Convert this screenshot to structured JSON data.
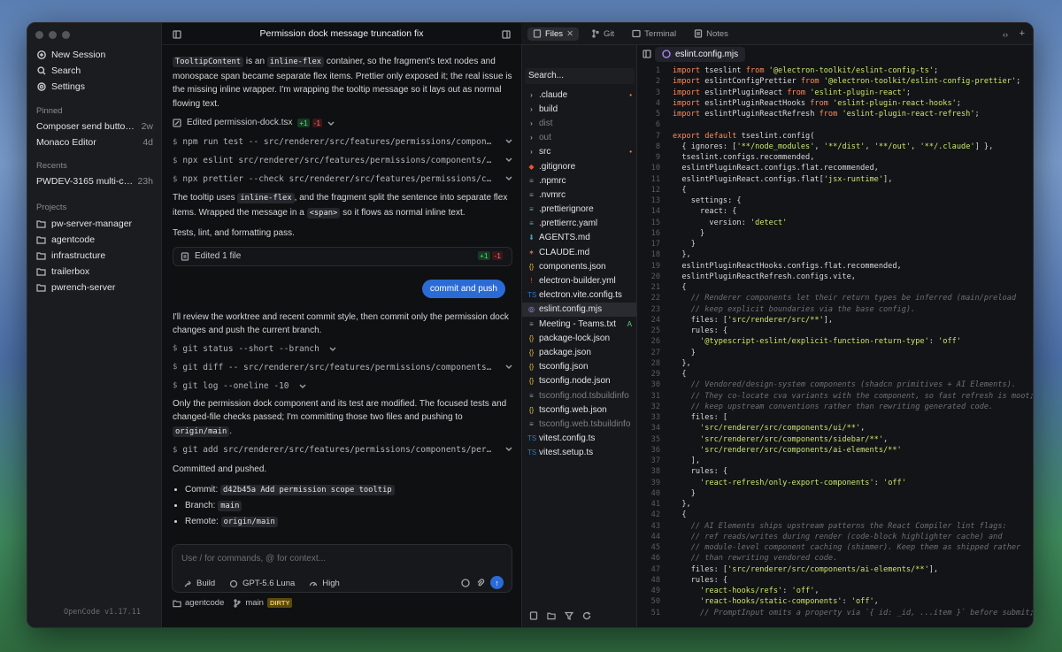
{
  "sidebar": {
    "nav": [
      {
        "label": "New Session",
        "icon": "plus-circle-icon"
      },
      {
        "label": "Search",
        "icon": "search-icon"
      },
      {
        "label": "Settings",
        "icon": "gear-icon"
      }
    ],
    "pinned_label": "Pinned",
    "pinned": [
      {
        "title": "Composer send button s...",
        "age": "2w"
      },
      {
        "title": "Monaco Editor",
        "age": "4d"
      }
    ],
    "recents_label": "Recents",
    "recents": [
      {
        "title": "PWDEV-3165 multi-com...",
        "age": "23h"
      }
    ],
    "projects_label": "Projects",
    "projects": [
      "pw-server-manager",
      "agentcode",
      "infrastructure",
      "trailerbox",
      "pwrench-server"
    ],
    "version": "OpenCode v1.17.11"
  },
  "chat": {
    "title": "Permission dock message truncation fix",
    "msg1_parts": [
      "TooltipContent",
      " is an ",
      "inline-flex",
      " container, so the fragment's text nodes and monospace span became separate flex items. Prettier only exposed it; the real issue is the missing inline wrapper. I'm wrapping the tooltip message so it lays out as normal flowing text."
    ],
    "edited1": "Edited permission-dock.tsx",
    "edited1_plus": "+1",
    "edited1_minus": "-1",
    "cmds1": [
      "npm run test -- src/renderer/src/features/permissions/components/pe...",
      "npx eslint src/renderer/src/features/permissions/components/permiss...",
      "npx prettier --check src/renderer/src/features/permissions/componen..."
    ],
    "msg2_parts": [
      "The tooltip uses ",
      "inline-flex",
      ", and the fragment split the sentence into separate flex items. Wrapped the message in a ",
      "<span>",
      " so it flows as normal inline text."
    ],
    "msg3": "Tests, lint, and formatting pass.",
    "card": "Edited 1 file",
    "card_plus": "+1",
    "card_minus": "-1",
    "user": "commit and push",
    "msg4": "I'll review the worktree and recent commit style, then commit only the permission dock changes and push the current branch.",
    "cmds2": [
      "git status --short --branch",
      "git diff -- src/renderer/src/features/permissions/components/permis...",
      "git log --oneline -10"
    ],
    "msg5_parts": [
      "Only the permission dock component and its test are modified. The focused tests and changed-file checks passed; I'm committing those two files and pushing to ",
      "origin/main",
      "."
    ],
    "cmd3": "git add src/renderer/src/features/permissions/components/permission...",
    "msg6": "Committed and pushed.",
    "bullets": [
      {
        "k": "Commit: ",
        "v": "d42b45a Add permission scope tooltip"
      },
      {
        "k": "Branch: ",
        "v": "main"
      },
      {
        "k": "Remote: ",
        "v": "origin/main"
      }
    ],
    "input_placeholder": "Use / for commands, @ for context...",
    "mode": "Build",
    "model": "GPT-5.6 Luna",
    "effort": "High",
    "footer_project": "agentcode",
    "footer_branch": "main",
    "footer_status": "DIRTY"
  },
  "tabs": [
    {
      "label": "Files",
      "active": true
    },
    {
      "label": "Git"
    },
    {
      "label": "Terminal"
    },
    {
      "label": "Notes"
    }
  ],
  "files": {
    "search_placeholder": "Search...",
    "items": [
      {
        "name": ".claude",
        "kind": "folder",
        "mark": "•",
        "mark_color": "#ff7a59"
      },
      {
        "name": "build",
        "kind": "folder"
      },
      {
        "name": "dist",
        "kind": "folder",
        "dim": true
      },
      {
        "name": "out",
        "kind": "folder",
        "dim": true
      },
      {
        "name": "src",
        "kind": "folder",
        "mark": "•",
        "mark_color": "#ff7a59"
      },
      {
        "name": ".gitignore",
        "kind": "git"
      },
      {
        "name": ".npmrc",
        "kind": "file"
      },
      {
        "name": ".nvmrc",
        "kind": "file"
      },
      {
        "name": ".prettierignore",
        "kind": "prettier"
      },
      {
        "name": ".prettierrc.yaml",
        "kind": "prettier"
      },
      {
        "name": "AGENTS.md",
        "kind": "md"
      },
      {
        "name": "CLAUDE.md",
        "kind": "claude"
      },
      {
        "name": "components.json",
        "kind": "json"
      },
      {
        "name": "electron-builder.yml",
        "kind": "yml"
      },
      {
        "name": "electron.vite.config.ts",
        "kind": "ts"
      },
      {
        "name": "eslint.config.mjs",
        "kind": "eslint",
        "selected": true
      },
      {
        "name": "Meeting - Teams.txt",
        "kind": "txt",
        "mark": "A",
        "mark_color": "#5fd37a"
      },
      {
        "name": "package-lock.json",
        "kind": "json"
      },
      {
        "name": "package.json",
        "kind": "json"
      },
      {
        "name": "tsconfig.json",
        "kind": "json"
      },
      {
        "name": "tsconfig.node.json",
        "kind": "json"
      },
      {
        "name": "tsconfig.nod.tsbuildinfo",
        "kind": "file",
        "dim": true
      },
      {
        "name": "tsconfig.web.json",
        "kind": "json"
      },
      {
        "name": "tsconfig.web.tsbuildinfo",
        "kind": "file",
        "dim": true
      },
      {
        "name": "vitest.config.ts",
        "kind": "ts"
      },
      {
        "name": "vitest.setup.ts",
        "kind": "ts"
      }
    ]
  },
  "editor": {
    "tab": "eslint.config.mjs",
    "lines": [
      [
        [
          "kw",
          "import "
        ],
        [
          "pl",
          "tseslint "
        ],
        [
          "kw",
          "from "
        ],
        [
          "str",
          "'@electron-toolkit/eslint-config-ts'"
        ],
        [
          "pl",
          ";"
        ]
      ],
      [
        [
          "kw",
          "import "
        ],
        [
          "pl",
          "eslintConfigPrettier "
        ],
        [
          "kw",
          "from "
        ],
        [
          "str",
          "'@electron-toolkit/eslint-config-prettier'"
        ],
        [
          "pl",
          ";"
        ]
      ],
      [
        [
          "kw",
          "import "
        ],
        [
          "pl",
          "eslintPluginReact "
        ],
        [
          "kw",
          "from "
        ],
        [
          "str",
          "'eslint-plugin-react'"
        ],
        [
          "pl",
          ";"
        ]
      ],
      [
        [
          "kw",
          "import "
        ],
        [
          "pl",
          "eslintPluginReactHooks "
        ],
        [
          "kw",
          "from "
        ],
        [
          "str",
          "'eslint-plugin-react-hooks'"
        ],
        [
          "pl",
          ";"
        ]
      ],
      [
        [
          "kw",
          "import "
        ],
        [
          "pl",
          "eslintPluginReactRefresh "
        ],
        [
          "kw",
          "from "
        ],
        [
          "str",
          "'eslint-plugin-react-refresh'"
        ],
        [
          "pl",
          ";"
        ]
      ],
      [],
      [
        [
          "kw",
          "export default "
        ],
        [
          "pl",
          "tseslint.config("
        ]
      ],
      [
        [
          "pl",
          "  { ignores: ["
        ],
        [
          "str",
          "'**/node_modules'"
        ],
        [
          "pl",
          ", "
        ],
        [
          "str",
          "'**/dist'"
        ],
        [
          "pl",
          ", "
        ],
        [
          "str",
          "'**/out'"
        ],
        [
          "pl",
          ", "
        ],
        [
          "str",
          "'**/.claude'"
        ],
        [
          "pl",
          "] },"
        ]
      ],
      [
        [
          "pl",
          "  tseslint.configs.recommended,"
        ]
      ],
      [
        [
          "pl",
          "  eslintPluginReact.configs.flat.recommended,"
        ]
      ],
      [
        [
          "pl",
          "  eslintPluginReact.configs.flat["
        ],
        [
          "str",
          "'jsx-runtime'"
        ],
        [
          "pl",
          "],"
        ]
      ],
      [
        [
          "pl",
          "  {"
        ]
      ],
      [
        [
          "pl",
          "    settings: {"
        ]
      ],
      [
        [
          "pl",
          "      react: {"
        ]
      ],
      [
        [
          "pl",
          "        version: "
        ],
        [
          "str",
          "'detect'"
        ]
      ],
      [
        [
          "pl",
          "      }"
        ]
      ],
      [
        [
          "pl",
          "    }"
        ]
      ],
      [
        [
          "pl",
          "  },"
        ]
      ],
      [
        [
          "pl",
          "  eslintPluginReactHooks.configs.flat.recommended,"
        ]
      ],
      [
        [
          "pl",
          "  eslintPluginReactRefresh.configs.vite,"
        ]
      ],
      [
        [
          "pl",
          "  {"
        ]
      ],
      [
        [
          "cm",
          "    // Renderer components let their return types be inferred (main/preload"
        ]
      ],
      [
        [
          "cm",
          "    // keep explicit boundaries via the base config)."
        ]
      ],
      [
        [
          "pl",
          "    files: ["
        ],
        [
          "str",
          "'src/renderer/src/**'"
        ],
        [
          "pl",
          "],"
        ]
      ],
      [
        [
          "pl",
          "    rules: {"
        ]
      ],
      [
        [
          "str",
          "      '@typescript-eslint/explicit-function-return-type'"
        ],
        [
          "pl",
          ": "
        ],
        [
          "str",
          "'off'"
        ]
      ],
      [
        [
          "pl",
          "    }"
        ]
      ],
      [
        [
          "pl",
          "  },"
        ]
      ],
      [
        [
          "pl",
          "  {"
        ]
      ],
      [
        [
          "cm",
          "    // Vendored/design-system components (shadcn primitives + AI Elements)."
        ]
      ],
      [
        [
          "cm",
          "    // They co-locate cva variants with the component, so fast refresh is moot;"
        ]
      ],
      [
        [
          "cm",
          "    // keep upstream conventions rather than rewriting generated code."
        ]
      ],
      [
        [
          "pl",
          "    files: ["
        ]
      ],
      [
        [
          "str",
          "      'src/renderer/src/components/ui/**'"
        ],
        [
          "pl",
          ","
        ]
      ],
      [
        [
          "str",
          "      'src/renderer/src/components/sidebar/**'"
        ],
        [
          "pl",
          ","
        ]
      ],
      [
        [
          "str",
          "      'src/renderer/src/components/ai-elements/**'"
        ]
      ],
      [
        [
          "pl",
          "    ],"
        ]
      ],
      [
        [
          "pl",
          "    rules: {"
        ]
      ],
      [
        [
          "str",
          "      'react-refresh/only-export-components'"
        ],
        [
          "pl",
          ": "
        ],
        [
          "str",
          "'off'"
        ]
      ],
      [
        [
          "pl",
          "    }"
        ]
      ],
      [
        [
          "pl",
          "  },"
        ]
      ],
      [
        [
          "pl",
          "  {"
        ]
      ],
      [
        [
          "cm",
          "    // AI Elements ships upstream patterns the React Compiler lint flags:"
        ]
      ],
      [
        [
          "cm",
          "    // ref reads/writes during render (code-block highlighter cache) and"
        ]
      ],
      [
        [
          "cm",
          "    // module-level component caching (shimmer). Keep them as shipped rather"
        ]
      ],
      [
        [
          "cm",
          "    // than rewriting vendored code."
        ]
      ],
      [
        [
          "pl",
          "    files: ["
        ],
        [
          "str",
          "'src/renderer/src/components/ai-elements/**'"
        ],
        [
          "pl",
          "],"
        ]
      ],
      [
        [
          "pl",
          "    rules: {"
        ]
      ],
      [
        [
          "str",
          "      'react-hooks/refs'"
        ],
        [
          "pl",
          ": "
        ],
        [
          "str",
          "'off'"
        ],
        [
          "pl",
          ","
        ]
      ],
      [
        [
          "str",
          "      'react-hooks/static-components'"
        ],
        [
          "pl",
          ": "
        ],
        [
          "str",
          "'off'"
        ],
        [
          "pl",
          ","
        ]
      ],
      [
        [
          "cm",
          "      // PromptInput omits a property via `{ id: _id, ...item }` before submit;"
        ]
      ]
    ]
  },
  "colors": {
    "accent": "#2b6bd6",
    "plus": "#5fd37a",
    "minus": "#ff6b6b",
    "dirty": "#f1c64a"
  }
}
